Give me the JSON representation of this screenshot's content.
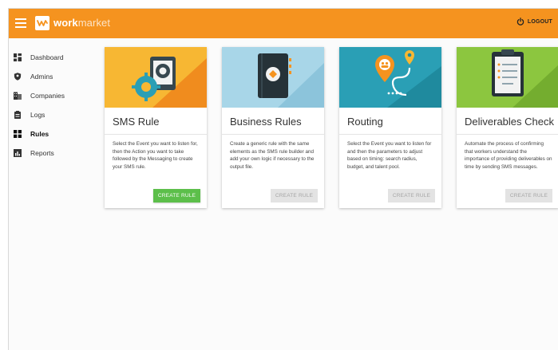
{
  "header": {
    "logo_bold": "work",
    "logo_light": "market",
    "logout_label": "LOGOUT"
  },
  "sidebar": {
    "items": [
      {
        "label": "Dashboard",
        "icon": "dashboard-icon"
      },
      {
        "label": "Admins",
        "icon": "shield-icon"
      },
      {
        "label": "Companies",
        "icon": "building-icon"
      },
      {
        "label": "Logs",
        "icon": "clipboard-icon"
      },
      {
        "label": "Rules",
        "icon": "rules-icon",
        "active": true
      },
      {
        "label": "Reports",
        "icon": "bar-chart-icon"
      }
    ]
  },
  "cards": [
    {
      "title": "SMS Rule",
      "description": "Select the Event you want to listen for, then the Action you want to take followed by the Messaging to create your SMS rule.",
      "button": "CREATE RULE",
      "button_enabled": true,
      "image_color": "#f7b733"
    },
    {
      "title": "Business Rules",
      "description": "Create a generic rule with the same elements as the SMS rule builder and add your own logic if necessary to the output file.",
      "button": "CREATE RULE",
      "button_enabled": false,
      "image_color": "#a8d6e8"
    },
    {
      "title": "Routing",
      "description": "Select the Event you want to listen for and then the parameters to adjust based on timing: search radius, budget, and talent pool.",
      "button": "CREATE RULE",
      "button_enabled": false,
      "image_color": "#2a9fb5"
    },
    {
      "title": "Deliverables Check",
      "description": "Automate the process of confirming that workers understand the importance of providing deliverables on time by sending SMS messages.",
      "button": "CREATE RULE",
      "button_enabled": false,
      "image_color": "#8cc63f"
    }
  ],
  "colors": {
    "topbar": "#f5931f",
    "enabled_button": "#5cbf4a",
    "disabled_button": "#e3e3e3"
  }
}
